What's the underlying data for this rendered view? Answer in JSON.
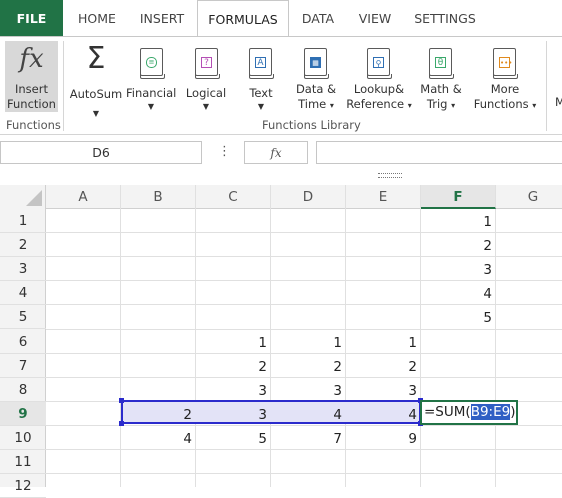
{
  "tabs": [
    {
      "label": "FILE"
    },
    {
      "label": "HOME"
    },
    {
      "label": "INSERT"
    },
    {
      "label": "FORMULAS"
    },
    {
      "label": "DATA"
    },
    {
      "label": "VIEW"
    },
    {
      "label": "SETTINGS"
    }
  ],
  "ribbon": {
    "insert_function": {
      "line1": "Insert",
      "line2": "Function"
    },
    "functions_group": "Functions",
    "autosum": "AutoSum",
    "financial": "Financial",
    "logical": "Logical",
    "text": "Text",
    "datetime": {
      "line1": "Data &",
      "line2": "Time"
    },
    "lookup": {
      "line1": "Lookup&",
      "line2": "Reference"
    },
    "math": {
      "line1": "Math &",
      "line2": "Trig"
    },
    "more": {
      "line1": "More",
      "line2": "Functions"
    },
    "library_group": "Functions Library",
    "cut_off": "M"
  },
  "formula_bar": {
    "name_box": "D6",
    "kebab": "⋮",
    "fx": "fx",
    "value": ""
  },
  "grid": {
    "columns": [
      "A",
      "B",
      "C",
      "D",
      "E",
      "F",
      "G"
    ],
    "rows": [
      "1",
      "2",
      "3",
      "4",
      "5",
      "6",
      "7",
      "8",
      "9",
      "10",
      "11",
      "12"
    ],
    "cells": {
      "F1": "1",
      "F2": "2",
      "F3": "3",
      "F4": "4",
      "F5": "5",
      "C6": "1",
      "D6": "1",
      "E6": "1",
      "C7": "2",
      "D7": "2",
      "E7": "2",
      "C8": "3",
      "D8": "3",
      "E8": "3",
      "B9": "2",
      "C9": "3",
      "D9": "4",
      "E9": "4",
      "B10": "4",
      "C10": "5",
      "D10": "7",
      "E10": "9"
    },
    "editing_cell": {
      "ref": "F9",
      "prefix": "=SUM(",
      "range": "B9:E9",
      "suffix": ")"
    }
  },
  "colors": {
    "accent": "#217346",
    "range_border": "#2b2bcc",
    "range_fill": "#e3e3f7"
  }
}
